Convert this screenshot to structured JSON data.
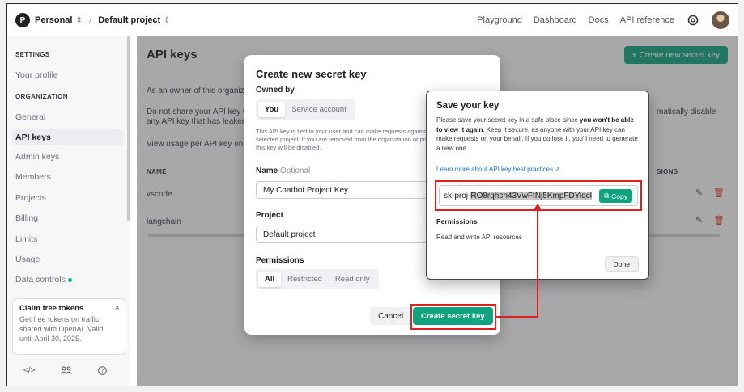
{
  "header": {
    "org_initial": "P",
    "org_name": "Personal",
    "project_name": "Default project",
    "nav": [
      "Playground",
      "Dashboard",
      "Docs",
      "API reference"
    ]
  },
  "sidebar": {
    "settings_title": "SETTINGS",
    "your_profile": "Your profile",
    "organization_title": "ORGANIZATION",
    "items": [
      "General",
      "API keys",
      "Admin keys",
      "Members",
      "Projects",
      "Billing",
      "Limits",
      "Usage",
      "Data controls"
    ],
    "active_item": "API keys",
    "promo": {
      "title": "Claim free tokens",
      "body": "Get free tokens on traffic shared with OpenAI. Valid until April 30, 2025."
    }
  },
  "main": {
    "title": "API keys",
    "create_button": "+ Create new secret key",
    "line1": "As an owner of this organiza",
    "line2a": "Do not share your API key w",
    "line2b": "any API key that has leaked",
    "line2_right": "matically disable",
    "line3": "View usage per API key on t",
    "col_name": "NAME",
    "col_perm": "SIONS",
    "rows": [
      "vscode",
      "langchain"
    ]
  },
  "create_modal": {
    "title": "Create new secret key",
    "owned_by_label": "Owned by",
    "owned_by_options": [
      "You",
      "Service account"
    ],
    "owned_by_selected": "You",
    "hint": "This API key is tied to your user and can make requests against the selected project. If you are removed from the organization or project, this key will be disabled.",
    "name_label": "Name",
    "name_optional": "Optional",
    "name_value": "My Chatbot Project Key",
    "project_label": "Project",
    "project_value": "Default project",
    "permissions_label": "Permissions",
    "permission_options": [
      "All",
      "Restricted",
      "Read only"
    ],
    "permission_selected": "All",
    "cancel_label": "Cancel",
    "create_label": "Create secret key"
  },
  "save_dialog": {
    "title": "Save your key",
    "text_pre": "Please save your secret key in a safe place since ",
    "text_bold": "you won't be able to view it again",
    "text_post": ". Keep it secure, as anyone with your API key can make requests on your behalf. If you do lose it, you'll need to generate a new one.",
    "link": "Learn more about API key best practices ↗",
    "key_prefix": "sk-proj-",
    "key_rest": "RO8rqhcn43VwFtNj5KmpFDYiqcl",
    "copy_label": "Copy",
    "permissions_title": "Permissions",
    "permissions_value": "Read and write API resources",
    "done_label": "Done"
  },
  "colors": {
    "accent": "#10a37f",
    "highlight": "#e02020"
  }
}
